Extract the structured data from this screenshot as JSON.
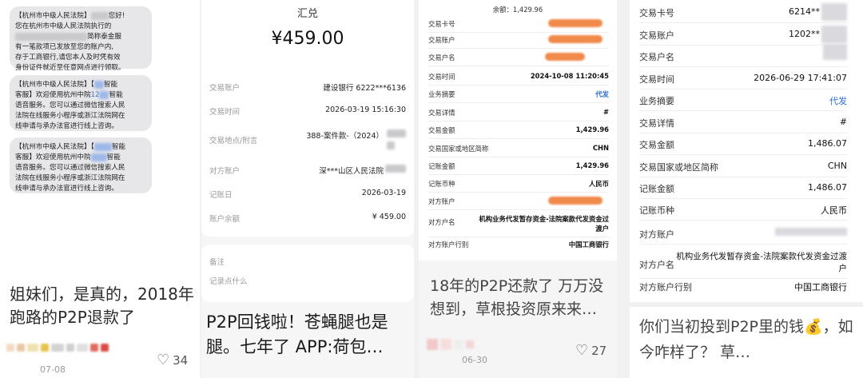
{
  "card1": {
    "sms": [
      {
        "lines": [
          "【杭州市中级人民法院】",
          "您好!",
          "您在杭州市中级人民法院执行的",
          "",
          "简称泰金服",
          "有一笔款项已发放至您的账户内,",
          "存于工商银行,请您本人及时凭有效",
          "身份证件就近至任意网点进行领取。"
        ]
      },
      {
        "lines": [
          "【杭州市中级人民法院】【",
          "智能",
          "客服】欢迎使用杭州中院",
          "12",
          "智能",
          "语音服务。您可以通过微信搜索人民",
          "法院在线服务小程序或浙江法院网在",
          "线申请与承办法官进行线上咨询。"
        ]
      },
      {
        "lines": [
          "【杭州市中级人民法院】【",
          "智能",
          "客服】欢迎使用杭州中院",
          "智能",
          "语音服务。您可以通过微信搜索人民",
          "法院在线服务小程序或浙江法院网在",
          "线申请与承办法官进行线上咨询。"
        ]
      }
    ],
    "title": "姐妹们，是真的，2018年跑路的P2P退款了",
    "date": "07-08",
    "likes": "34"
  },
  "card2": {
    "receipt_title": "汇兑",
    "amount": "¥459.00",
    "rows": [
      {
        "k": "交易账户",
        "v": "建设银行 6222***6136"
      },
      {
        "k": "交易时间",
        "v": "2026-03-19 15:16:30"
      },
      {
        "k": "交易地点/附言",
        "v": "388-案件款-（2024）"
      },
      {
        "k": "对方账户",
        "v": "深***山区人民法院"
      },
      {
        "k": "记账日",
        "v": "2026-03-19"
      },
      {
        "k": "账户余额",
        "v": "¥ 459.00"
      }
    ],
    "note_label": "备注",
    "note_placeholder": "记录点什么",
    "title": "P2P回钱啦！苍蝇腿也是腿。七年了 APP:荷包…"
  },
  "card3": {
    "balance": "余额：1,429.96",
    "rows": [
      {
        "k": "交易卡号",
        "v": ""
      },
      {
        "k": "交易账户",
        "v": ""
      },
      {
        "k": "交易户名",
        "v": ""
      },
      {
        "k": "交易时间",
        "v": "2024-10-08 11:20:45"
      },
      {
        "k": "业务摘要",
        "v": "代发"
      },
      {
        "k": "交易详情",
        "v": "#"
      },
      {
        "k": "交易金额",
        "v": "1,429.96"
      },
      {
        "k": "交易国家或地区简称",
        "v": "CHN"
      },
      {
        "k": "记账金额",
        "v": "1,429.96"
      },
      {
        "k": "记账币种",
        "v": "人民币"
      },
      {
        "k": "对方账户",
        "v": ""
      },
      {
        "k": "对方户名",
        "v": "机构业务代发暂存资金-法院案款代发资金过渡户"
      },
      {
        "k": "对方账户行别",
        "v": "中国工商银行"
      }
    ],
    "title": "18年的P2P还款了 万万没想到，草根投资原来来…",
    "date": "06-30",
    "likes": "27"
  },
  "card4": {
    "rows": [
      {
        "k": "交易卡号",
        "v": "6214**"
      },
      {
        "k": "交易账户",
        "v": "1202**"
      },
      {
        "k": "交易户名",
        "v": ""
      },
      {
        "k": "交易时间",
        "v": "2026-06-29 17:41:07"
      },
      {
        "k": "业务摘要",
        "v": "代发"
      },
      {
        "k": "交易详情",
        "v": "#"
      },
      {
        "k": "交易金额",
        "v": "1,486.07"
      },
      {
        "k": "交易国家或地区简称",
        "v": "CHN"
      },
      {
        "k": "记账金额",
        "v": "1,486.07"
      },
      {
        "k": "记账币种",
        "v": "人民币"
      },
      {
        "k": "对方账户",
        "v": ""
      },
      {
        "k": "对方户名",
        "v": "机构业务代发暂存资金-法院案款代发资金过渡户"
      },
      {
        "k": "对方账户行别",
        "v": "中国工商银行"
      }
    ],
    "title": "你们当初投到P2P里的钱💰，如今咋样了？ 草…"
  },
  "colors": {
    "accent_blue": "#2f6fd6",
    "redact_orange": "#f08a4b"
  }
}
